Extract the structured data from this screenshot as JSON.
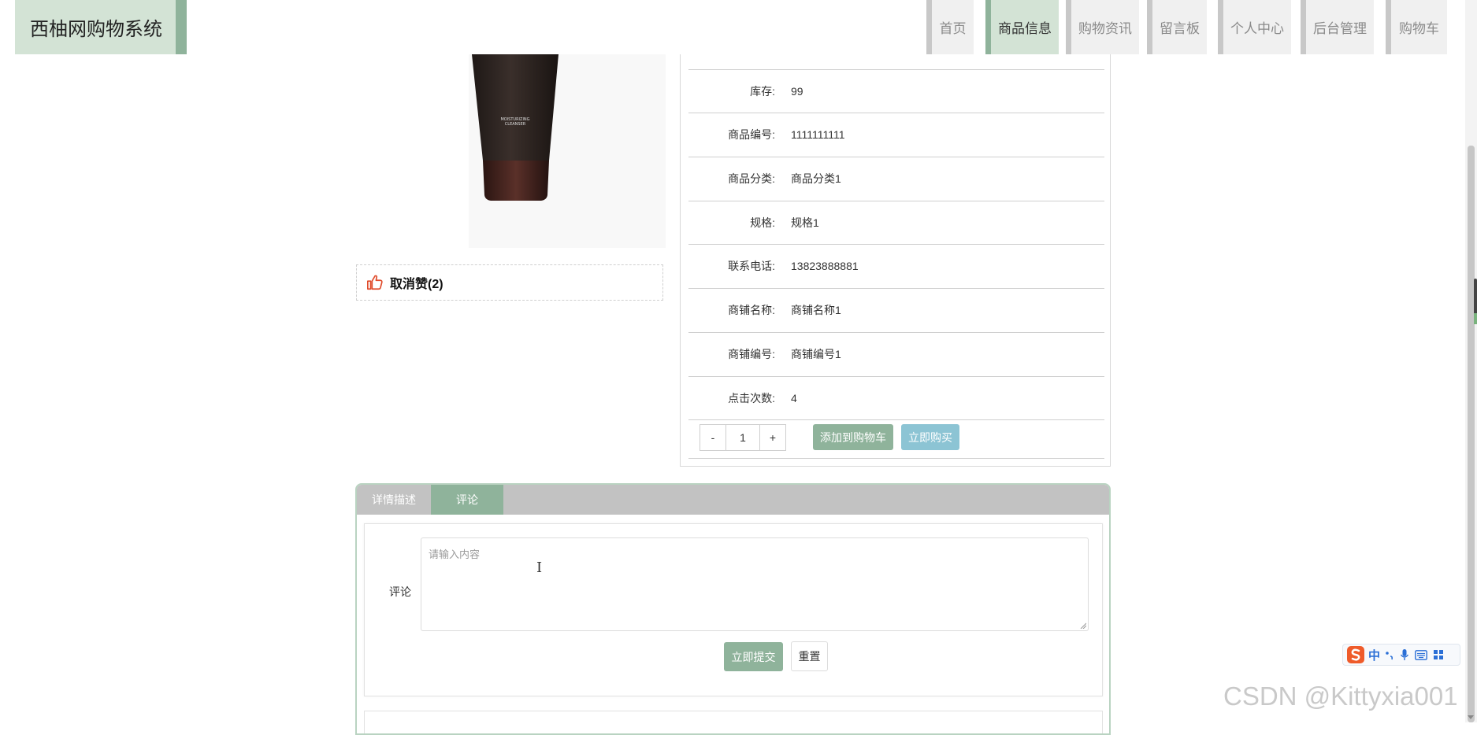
{
  "header": {
    "brand": "西柚网购物系统",
    "nav": [
      {
        "label": "首页",
        "active": false
      },
      {
        "label": "商品信息",
        "active": true
      },
      {
        "label": "购物资讯",
        "active": false
      },
      {
        "label": "留言板",
        "active": false
      },
      {
        "label": "个人中心",
        "active": false
      },
      {
        "label": "后台管理",
        "active": false
      },
      {
        "label": "购物车",
        "active": false
      }
    ]
  },
  "product": {
    "image_alt": "moisturizing-cleanser-tube",
    "tube_text_line1": "MOISTURIZING",
    "tube_text_line2": "CLEANSER",
    "like_text": "取消赞(2)"
  },
  "info": {
    "rows": [
      {
        "label": "库存:",
        "value": "99"
      },
      {
        "label": "商品编号:",
        "value": "1111111111"
      },
      {
        "label": "商品分类:",
        "value": "商品分类1"
      },
      {
        "label": "规格:",
        "value": "规格1"
      },
      {
        "label": "联系电话:",
        "value": "13823888881"
      },
      {
        "label": "商铺名称:",
        "value": "商铺名称1"
      },
      {
        "label": "商铺编号:",
        "value": "商铺编号1"
      },
      {
        "label": "点击次数:",
        "value": "4"
      }
    ],
    "quantity": {
      "minus": "-",
      "value": "1",
      "plus": "+"
    },
    "add_to_cart": "添加到购物车",
    "buy_now": "立即购买"
  },
  "tabs": {
    "items": [
      {
        "label": "详情描述",
        "active": false
      },
      {
        "label": "评论",
        "active": true
      }
    ],
    "comment": {
      "label": "评论",
      "placeholder": "请输入内容",
      "submit": "立即提交",
      "reset": "重置"
    }
  },
  "ime": {
    "mode": "中"
  },
  "watermark": "CSDN @Kittyxia001",
  "colors": {
    "accent": "#8fb39b",
    "accent_light": "#d3e3d5",
    "buy_button": "#8cc4d4",
    "tab_bar": "#c2c2c2"
  },
  "icons": [
    "thumbs-up-icon",
    "text-cursor-icon",
    "sogou-ime-icon"
  ]
}
